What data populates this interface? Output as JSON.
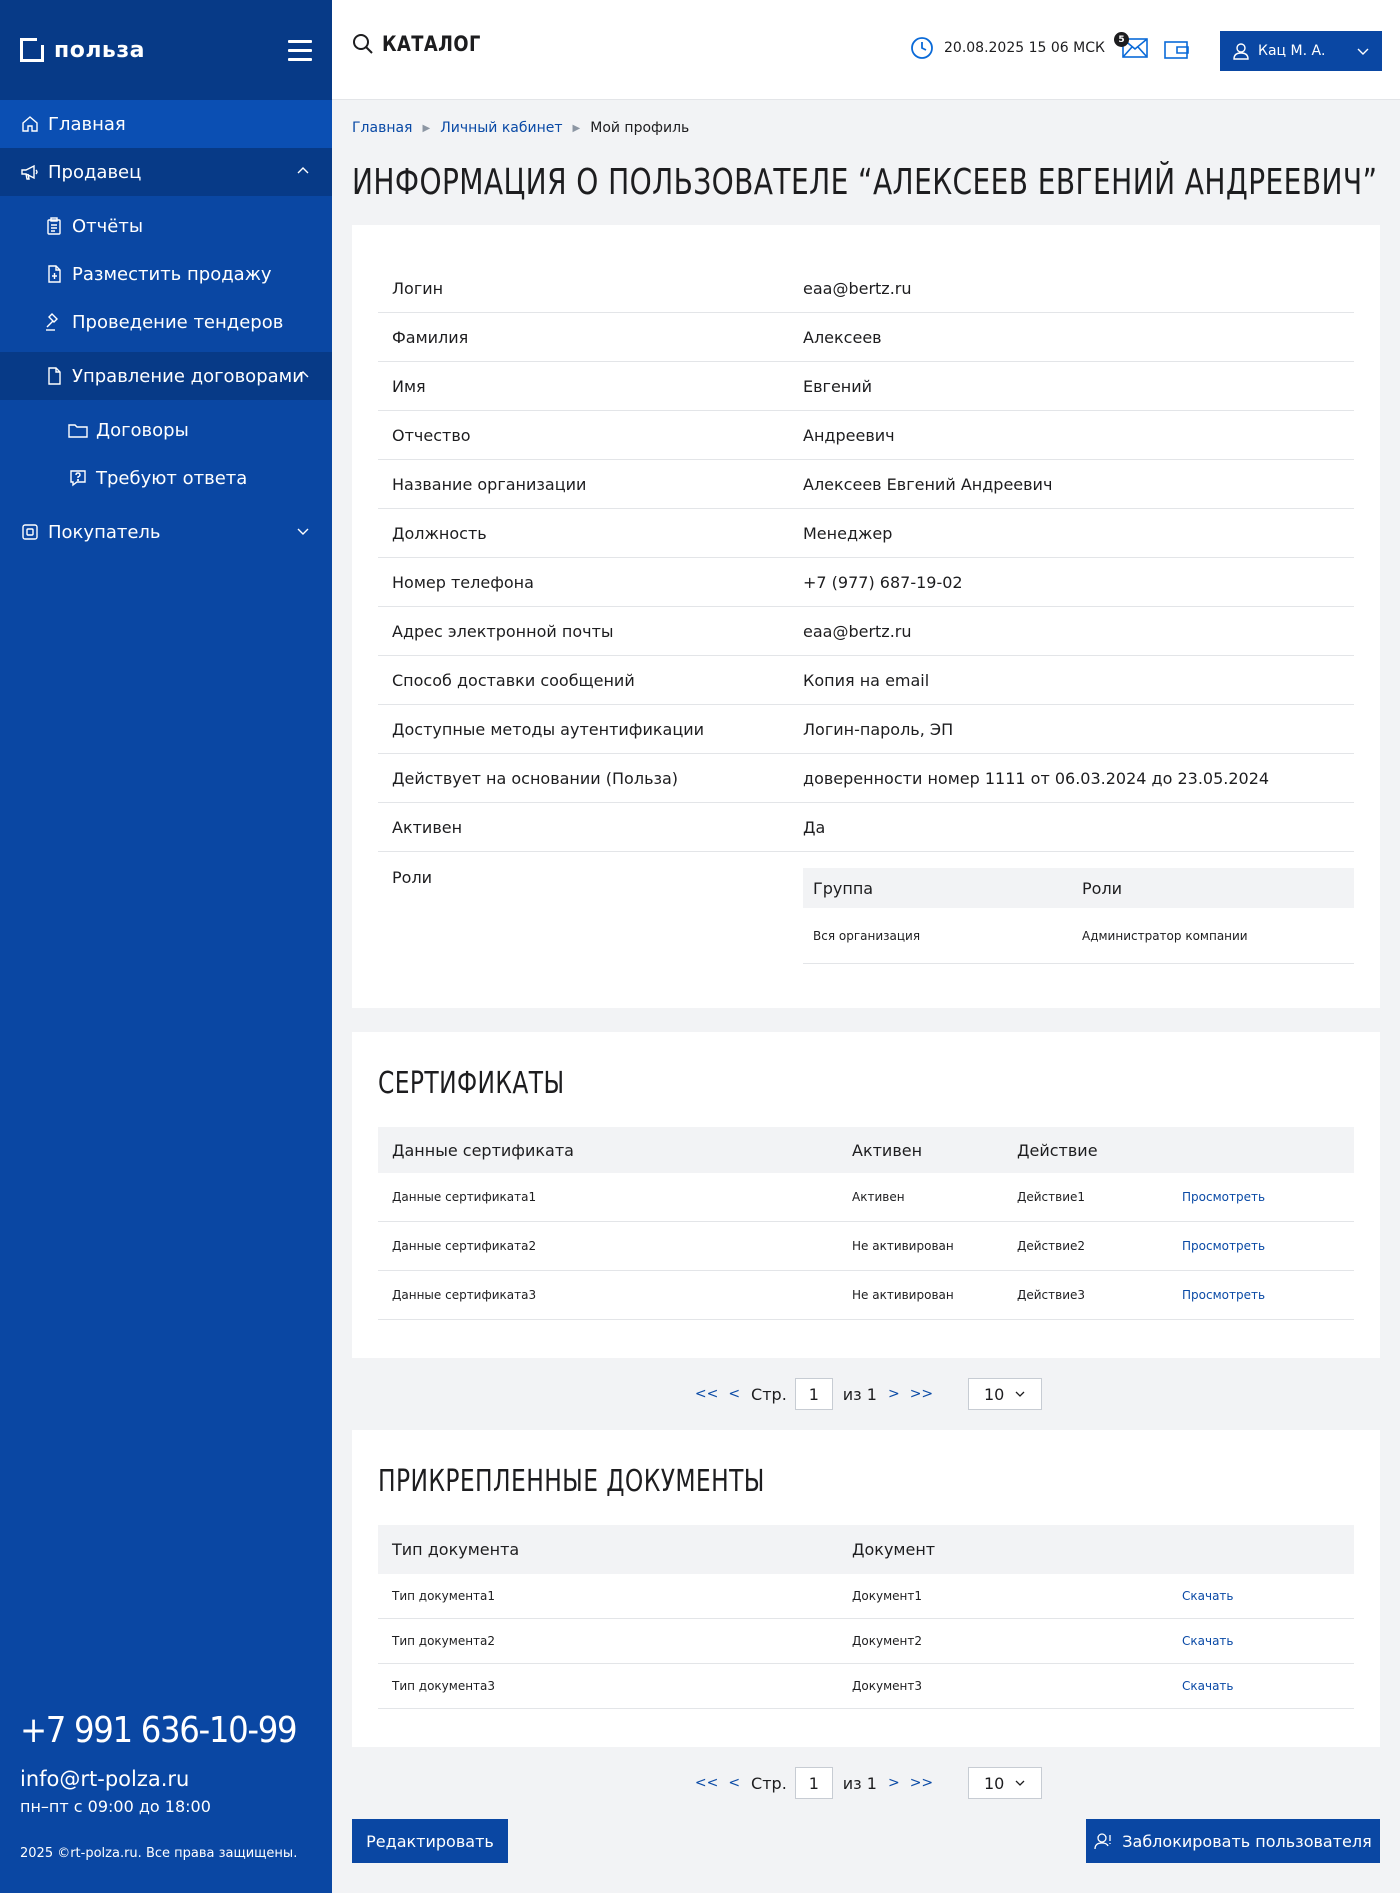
{
  "brand": {
    "logo_text": "польза"
  },
  "sidebar": {
    "home": "Главная",
    "seller": "Продавец",
    "reports": "Отчёты",
    "post_sale": "Разместить продажу",
    "tenders": "Проведение тендеров",
    "contracts_mgmt": "Управление договорами",
    "contracts": "Договоры",
    "need_reply": "Требуют ответа",
    "buyer": "Покупатель",
    "phone": "+7 991 636-10-99",
    "email": "info@rt-polza.ru",
    "hours": "пн–пт с 09:00 до 18:00",
    "copyright": "2025 ©rt-polza.ru. Все права защищены."
  },
  "header": {
    "catalog": "КАТАЛОГ",
    "datetime": "20.08.2025 15 06 МСК",
    "mail_count": "5",
    "user_name": "Кац М. А."
  },
  "breadcrumb": {
    "home": "Главная",
    "cabinet": "Личный кабинет",
    "current": "Мой профиль"
  },
  "page_title": "ИНФОРМАЦИЯ О ПОЛЬЗОВАТЕЛЕ “АЛЕКСЕЕВ ЕВГЕНИЙ АНДРЕЕВИЧ”",
  "profile": [
    {
      "label": "Логин",
      "value": "eaa@bertz.ru"
    },
    {
      "label": "Фамилия",
      "value": "Алексеев"
    },
    {
      "label": "Имя",
      "value": "Евгений"
    },
    {
      "label": "Отчество",
      "value": "Андреевич"
    },
    {
      "label": "Название организации",
      "value": "Алексеев Евгений Андреевич"
    },
    {
      "label": "Должность",
      "value": "Менеджер"
    },
    {
      "label": "Номер телефона",
      "value": "+7 (977) 687-19-02"
    },
    {
      "label": "Адрес электронной почты",
      "value": "eaa@bertz.ru"
    },
    {
      "label": "Способ доставки сообщений",
      "value": "Копия на email"
    },
    {
      "label": "Доступные методы аутентификации",
      "value": "Логин-пароль, ЭП"
    },
    {
      "label": "Действует на основании (Польза)",
      "value": "доверенности номер 1111 от 06.03.2024 до 23.05.2024"
    },
    {
      "label": "Активен",
      "value": "Да"
    }
  ],
  "roles": {
    "label": "Роли",
    "headers": [
      "Группа",
      "Роли"
    ],
    "rows": [
      {
        "group": "Вся организация",
        "role": "Администратор компании"
      }
    ]
  },
  "certificates": {
    "title": "СЕРТИФИКАТЫ",
    "headers": [
      "Данные сертификата",
      "Активен",
      "Действие"
    ],
    "rows": [
      {
        "data": "Данные сертификата1",
        "active": "Активен",
        "action": "Действие1",
        "link": "Просмотреть"
      },
      {
        "data": "Данные сертификата2",
        "active": "Не активирован",
        "action": "Действие2",
        "link": "Просмотреть"
      },
      {
        "data": "Данные сертификата3",
        "active": "Не активирован",
        "action": "Действие3",
        "link": "Просмотреть"
      }
    ]
  },
  "pager": {
    "first": "<<",
    "prev": "<",
    "page_label": "Стр.",
    "page": "1",
    "of": "из 1",
    "next": ">",
    "last": ">>",
    "page_size": "10"
  },
  "documents": {
    "title": "ПРИКРЕПЛЕННЫЕ ДОКУМЕНТЫ",
    "headers": [
      "Тип документа",
      "Документ"
    ],
    "rows": [
      {
        "type": "Тип документа1",
        "doc": "Документ1",
        "link": "Скачать"
      },
      {
        "type": "Тип документа2",
        "doc": "Документ2",
        "link": "Скачать"
      },
      {
        "type": "Тип документа3",
        "doc": "Документ3",
        "link": "Скачать"
      }
    ]
  },
  "actions": {
    "edit": "Редактировать",
    "block": "Заблокировать пользователя"
  },
  "colors": {
    "primary": "#0a47a3",
    "primary_dark": "#073a87",
    "link": "#0a4aa6",
    "bg": "#f2f3f5"
  }
}
